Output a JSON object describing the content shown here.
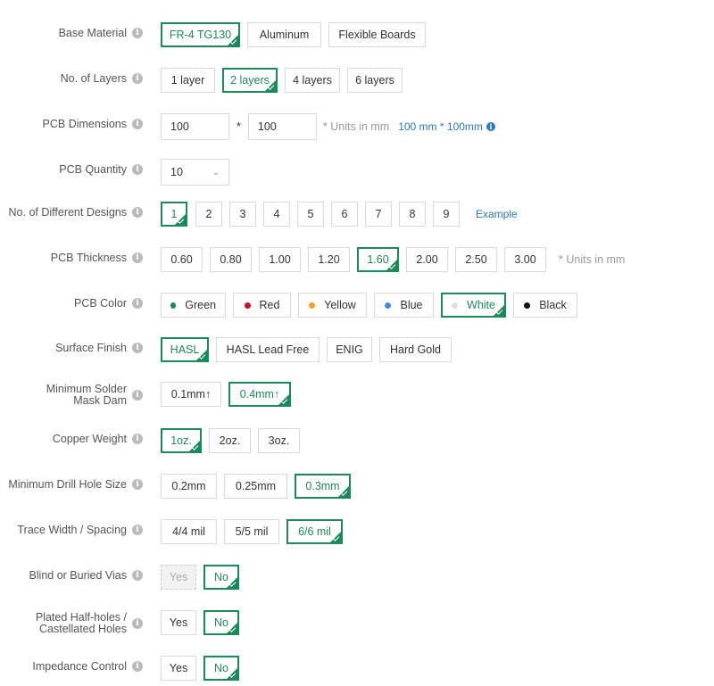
{
  "form": {
    "base_material": {
      "label": "Base Material",
      "options": [
        "FR-4 TG130",
        "Aluminum",
        "Flexible Boards"
      ]
    },
    "layers": {
      "label": "No. of Layers",
      "options": [
        "1 layer",
        "2 layers",
        "4 layers",
        "6 layers"
      ]
    },
    "dimensions": {
      "label": "PCB Dimensions",
      "width": "100",
      "sep": "*",
      "height": "100",
      "note": "* Units in mm",
      "summary": "100 mm * 100mm"
    },
    "quantity": {
      "label": "PCB Quantity",
      "value": "10"
    },
    "designs": {
      "label": "No. of Different Designs",
      "options": [
        "1",
        "2",
        "3",
        "4",
        "5",
        "6",
        "7",
        "8",
        "9"
      ],
      "example": "Example"
    },
    "thickness": {
      "label": "PCB Thickness",
      "options": [
        "0.60",
        "0.80",
        "1.00",
        "1.20",
        "1.60",
        "2.00",
        "2.50",
        "3.00"
      ],
      "note": "* Units in mm"
    },
    "color": {
      "label": "PCB Color",
      "options": [
        {
          "name": "Green",
          "dot": "#1a8a5a"
        },
        {
          "name": "Red",
          "dot": "#c8102e"
        },
        {
          "name": "Yellow",
          "dot": "#f0a020"
        },
        {
          "name": "Blue",
          "dot": "#4a8ad8"
        },
        {
          "name": "White",
          "dot": "#e0e0e0"
        },
        {
          "name": "Black",
          "dot": "#111111"
        }
      ]
    },
    "surface": {
      "label": "Surface Finish",
      "options": [
        "HASL",
        "HASL Lead Free",
        "ENIG",
        "Hard Gold"
      ]
    },
    "mask_dam": {
      "label": "Minimum Solder Mask Dam",
      "options": [
        "0.1mm↑",
        "0.4mm↑"
      ]
    },
    "copper": {
      "label": "Copper Weight",
      "options": [
        "1oz.",
        "2oz.",
        "3oz."
      ]
    },
    "drill": {
      "label": "Minimum Drill Hole Size",
      "options": [
        "0.2mm",
        "0.25mm",
        "0.3mm"
      ]
    },
    "trace": {
      "label": "Trace Width / Spacing",
      "options": [
        "4/4 mil",
        "5/5 mil",
        "6/6 mil"
      ]
    },
    "vias": {
      "label": "Blind or Buried Vias",
      "options": [
        "Yes",
        "No"
      ]
    },
    "half_holes": {
      "label": "Plated Half-holes / Castellated Holes",
      "options": [
        "Yes",
        "No"
      ]
    },
    "impedance": {
      "label": "Impedance Control",
      "options": [
        "Yes",
        "No"
      ]
    }
  },
  "colors": {
    "accent": "#1a8a5a",
    "link": "#2a7ab8",
    "info": "#bbbbbb"
  },
  "icons": {
    "info": "info-icon",
    "caret": "chevron-down-icon",
    "check": "check-corner-icon"
  }
}
